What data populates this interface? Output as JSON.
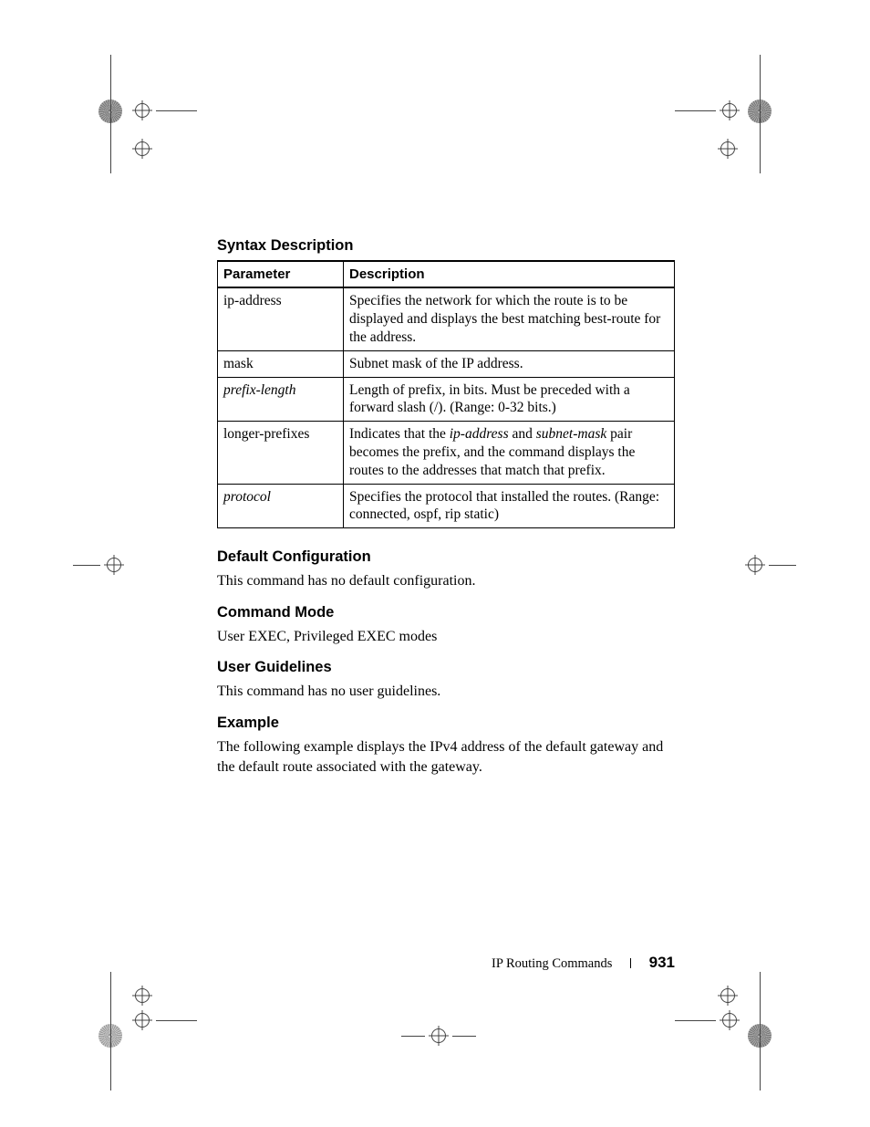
{
  "sections": {
    "syntax": {
      "heading": "Syntax Description",
      "table": {
        "headers": [
          "Parameter",
          "Description"
        ],
        "rows": [
          {
            "param": "ip-address",
            "param_italic": false,
            "desc_parts": [
              {
                "t": "Specifies the network for which the route is to be displayed and displays the best matching best-route for the address.",
                "i": false
              }
            ]
          },
          {
            "param": "mask",
            "param_italic": false,
            "desc_parts": [
              {
                "t": "Subnet mask of the IP address.",
                "i": false
              }
            ]
          },
          {
            "param": "prefix-length",
            "param_italic": true,
            "desc_parts": [
              {
                "t": "Length of prefix, in bits. Must be preceded with a forward slash (/). (Range: 0-32 bits.)",
                "i": false
              }
            ]
          },
          {
            "param": "longer-prefixes",
            "param_italic": false,
            "desc_parts": [
              {
                "t": "Indicates that the ",
                "i": false
              },
              {
                "t": "ip-address",
                "i": true
              },
              {
                "t": " and ",
                "i": false
              },
              {
                "t": "subnet-mask",
                "i": true
              },
              {
                "t": " pair becomes the prefix, and the command displays the routes to the addresses that match that prefix.",
                "i": false
              }
            ]
          },
          {
            "param": "protocol",
            "param_italic": true,
            "desc_parts": [
              {
                "t": "Specifies the protocol that installed the routes. (Range: connected, ospf, rip static)",
                "i": false
              }
            ]
          }
        ]
      }
    },
    "default_config": {
      "heading": "Default Configuration",
      "body": "This command has no default configuration."
    },
    "command_mode": {
      "heading": "Command Mode",
      "body": "User EXEC, Privileged EXEC modes"
    },
    "user_guidelines": {
      "heading": "User Guidelines",
      "body": "This command has no user guidelines."
    },
    "example": {
      "heading": "Example",
      "body": "The following example displays the IPv4 address of the default gateway and the default route associated with the gateway."
    }
  },
  "footer": {
    "section_title": "IP Routing Commands",
    "page_number": "931"
  }
}
